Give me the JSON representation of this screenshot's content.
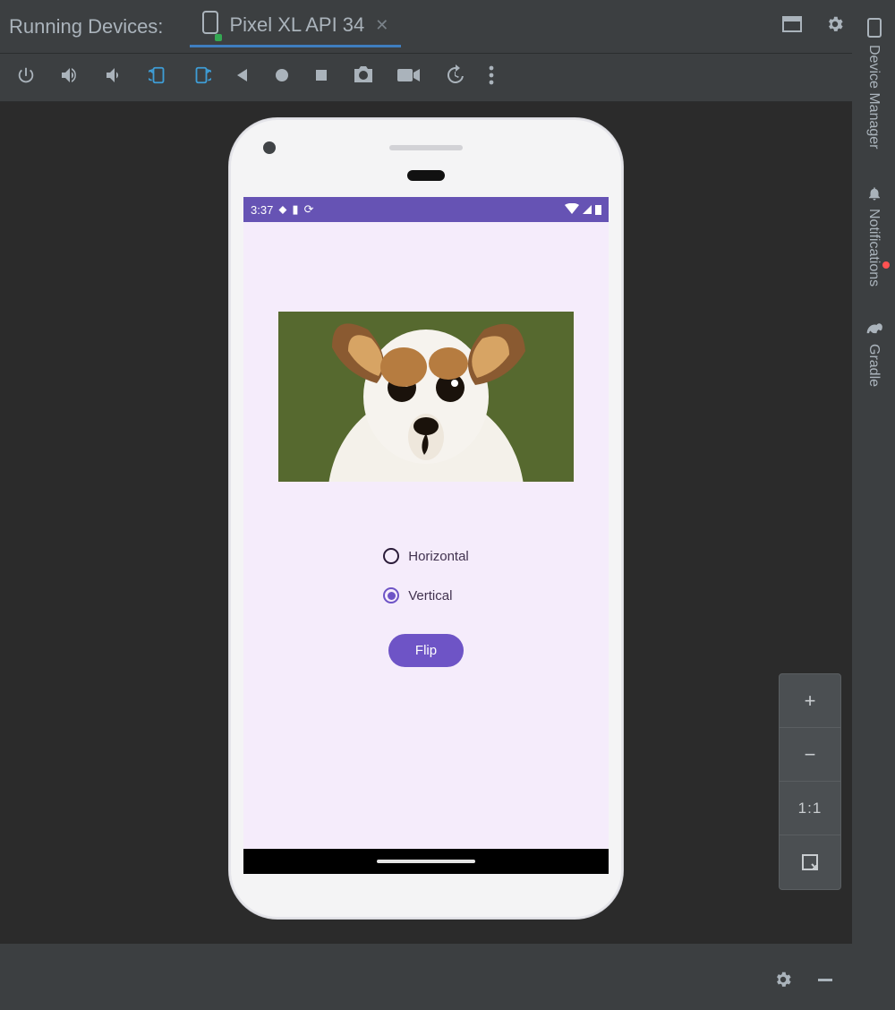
{
  "header": {
    "running_devices_label": "Running Devices:",
    "tab_label": "Pixel XL API 34"
  },
  "sidebar": [
    {
      "icon": "device",
      "label": "Device Manager"
    },
    {
      "icon": "bell",
      "label": "Notifications"
    },
    {
      "icon": "elephant",
      "label": "Gradle"
    }
  ],
  "zoom": {
    "plus": "+",
    "minus": "−",
    "one_to_one": "1:1"
  },
  "phone": {
    "status_time": "3:37",
    "options": [
      {
        "label": "Horizontal",
        "selected": false
      },
      {
        "label": "Vertical",
        "selected": true
      }
    ],
    "button_label": "Flip"
  }
}
